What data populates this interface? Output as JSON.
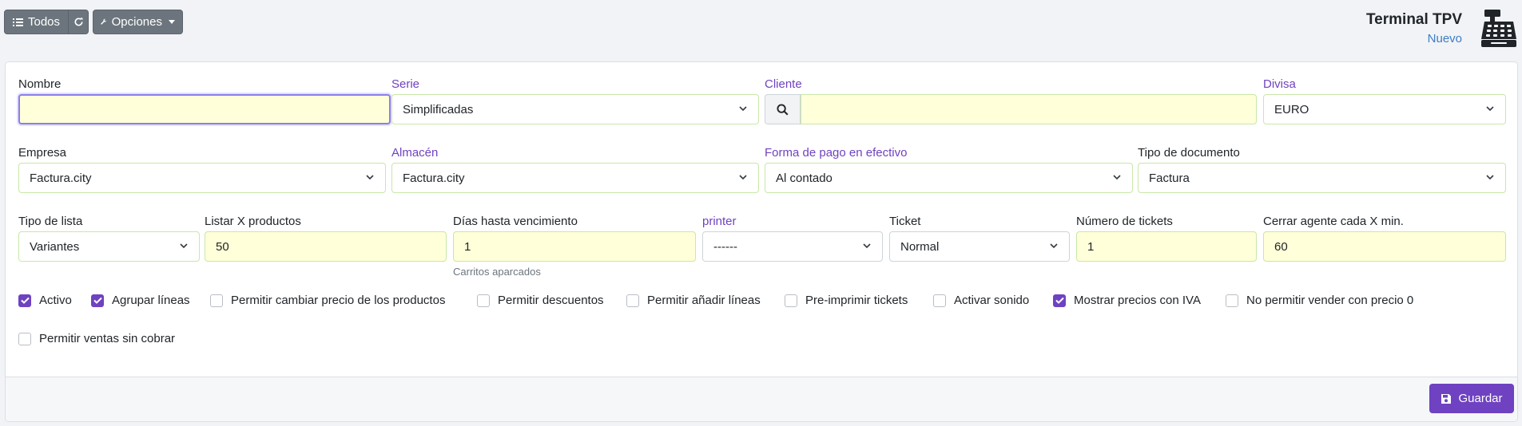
{
  "toolbar": {
    "all_label": "Todos",
    "options_label": "Opciones"
  },
  "header": {
    "title": "Terminal TPV",
    "subtitle": "Nuevo"
  },
  "form": {
    "nombre": {
      "label": "Nombre",
      "value": ""
    },
    "serie": {
      "label": "Serie",
      "value": "Simplificadas"
    },
    "cliente": {
      "label": "Cliente",
      "value": ""
    },
    "divisa": {
      "label": "Divisa",
      "value": "EURO"
    },
    "empresa": {
      "label": "Empresa",
      "value": "Factura.city"
    },
    "almacen": {
      "label": "Almacén",
      "value": "Factura.city"
    },
    "forma_pago": {
      "label": "Forma de pago en efectivo",
      "value": "Al contado"
    },
    "tipo_documento": {
      "label": "Tipo de documento",
      "value": "Factura"
    },
    "tipo_lista": {
      "label": "Tipo de lista",
      "value": "Variantes"
    },
    "listar_productos": {
      "label": "Listar X productos",
      "value": "50"
    },
    "dias_vencimiento": {
      "label": "Días hasta vencimiento",
      "value": "1",
      "help": "Carritos aparcados"
    },
    "printer": {
      "label": "printer",
      "value": "------"
    },
    "ticket": {
      "label": "Ticket",
      "value": "Normal"
    },
    "numero_tickets": {
      "label": "Número de tickets",
      "value": "1"
    },
    "cerrar_agente": {
      "label": "Cerrar agente cada X min.",
      "value": "60"
    }
  },
  "checkboxes": [
    {
      "label": "Activo",
      "checked": true
    },
    {
      "label": "Agrupar líneas",
      "checked": true
    },
    {
      "label": "Permitir cambiar precio de los productos",
      "checked": false
    },
    {
      "label": "Permitir descuentos",
      "checked": false
    },
    {
      "label": "Permitir añadir líneas",
      "checked": false
    },
    {
      "label": "Pre-imprimir tickets",
      "checked": false
    },
    {
      "label": "Activar sonido",
      "checked": false
    },
    {
      "label": "Mostrar precios con IVA",
      "checked": true
    },
    {
      "label": "No permitir vender con precio 0",
      "checked": false
    },
    {
      "label": "Permitir ventas sin cobrar",
      "checked": false
    }
  ],
  "footer": {
    "save_label": "Guardar"
  },
  "colors": {
    "accent": "#6f42c1",
    "field_bg": "#ffffd9",
    "subtitle": "#3f7cc4"
  }
}
